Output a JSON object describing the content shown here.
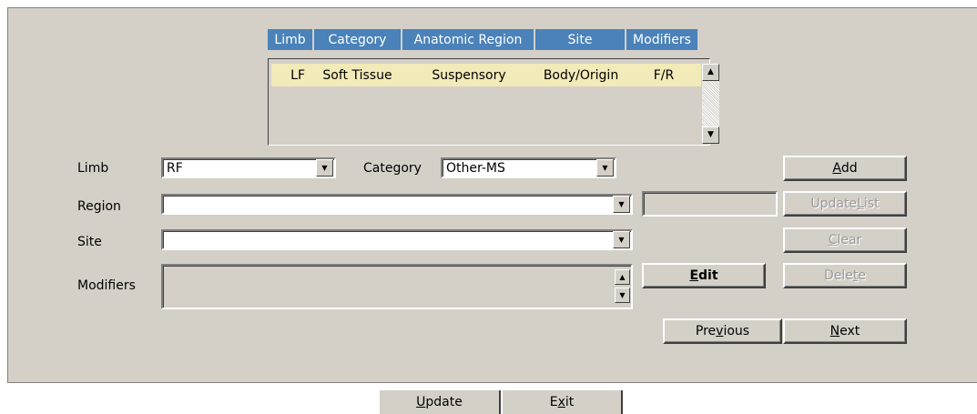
{
  "table": {
    "headers": [
      "Limb",
      "Category",
      "Anatomic Region",
      "Site",
      "Modifiers"
    ],
    "rows": [
      {
        "limb": "LF",
        "category": "Soft Tissue",
        "region": "Suspensory",
        "site": "Body/Origin",
        "modifiers": "F/R"
      }
    ]
  },
  "form": {
    "limb_label": "Limb",
    "limb_value": "RF",
    "category_label": "Category",
    "category_value": "Other-MS",
    "region_label": "Region",
    "region_value": "",
    "region_extra_value": "",
    "site_label": "Site",
    "site_value": "",
    "modifiers_label": "Modifiers",
    "modifiers_value": ""
  },
  "buttons": {
    "add": {
      "pre": "",
      "key": "A",
      "post": "dd"
    },
    "update_list": {
      "pre": "Update ",
      "key": "L",
      "post": "ist"
    },
    "clear": {
      "pre": "",
      "key": "C",
      "post": "lear"
    },
    "delete": {
      "pre": "Dele",
      "key": "t",
      "post": "e"
    },
    "edit": {
      "pre": "",
      "key": "E",
      "post": "dit"
    },
    "previous": {
      "pre": "Pre",
      "key": "v",
      "post": "ious"
    },
    "next": {
      "pre": "",
      "key": "N",
      "post": "ext"
    },
    "update": {
      "pre": "",
      "key": "U",
      "post": "pdate"
    },
    "exit": {
      "pre": "E",
      "key": "x",
      "post": "it"
    }
  },
  "icons": {
    "scroll_up": "triangle-up",
    "scroll_down": "triangle-down",
    "dropdown": "triangle-down"
  }
}
